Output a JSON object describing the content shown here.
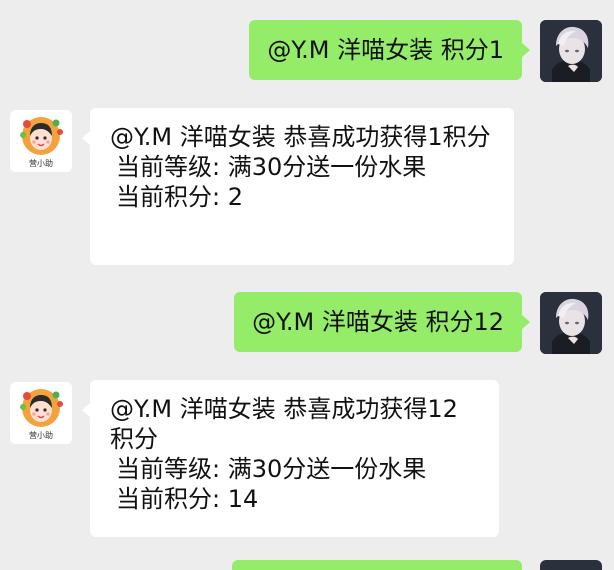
{
  "messages": [
    {
      "side": "sent",
      "text": "@Y.M 洋喵女装 积分1"
    },
    {
      "side": "received",
      "headline": "@Y.M 洋喵女装 恭喜成功获得1积分",
      "level_line": "当前等级: 满30分送一份水果",
      "points_line": "当前积分: 2"
    },
    {
      "side": "sent",
      "text": "@Y.M 洋喵女装 积分12"
    },
    {
      "side": "received",
      "headline": "@Y.M 洋喵女装 恭喜成功获得12积分",
      "level_line": "当前等级: 满30分送一份水果",
      "points_line": "当前积分: 14"
    }
  ],
  "avatars": {
    "user_icon": "user-avatar",
    "bot_icon": "bot-avatar",
    "bot_caption": "营小助"
  },
  "colors": {
    "chat_background": "#ededed",
    "sent_bubble": "#95ec69",
    "received_bubble": "#ffffff"
  }
}
